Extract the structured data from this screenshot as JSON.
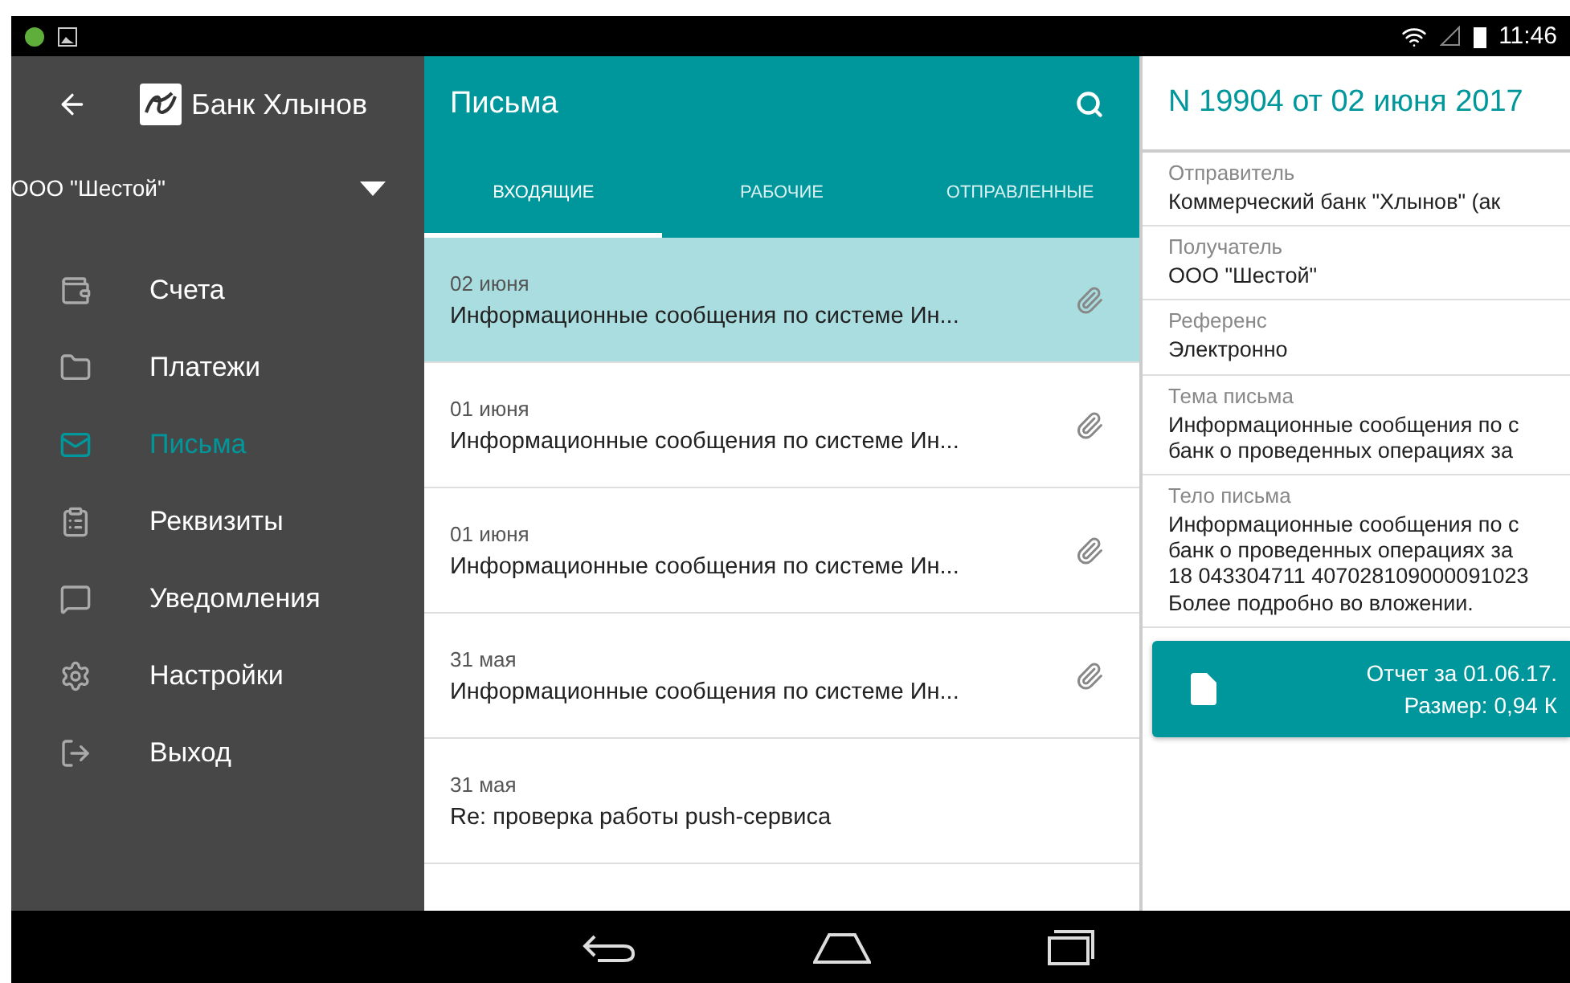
{
  "status_bar": {
    "time": "11:46"
  },
  "sidebar": {
    "bank_name": "Банк Хлынов",
    "organization": "ООО \"Шестой\"",
    "items": [
      {
        "label": "Счета",
        "selected": false
      },
      {
        "label": "Платежи",
        "selected": false
      },
      {
        "label": "Письма",
        "selected": true
      },
      {
        "label": "Реквизиты",
        "selected": false
      },
      {
        "label": "Уведомления",
        "selected": false
      },
      {
        "label": "Настройки",
        "selected": false
      },
      {
        "label": "Выход",
        "selected": false
      }
    ]
  },
  "letters": {
    "title": "Письма",
    "tabs": [
      {
        "label": "ВХОДЯЩИЕ",
        "selected": true
      },
      {
        "label": "РАБОЧИЕ",
        "selected": false
      },
      {
        "label": "ОТПРАВЛЕННЫЕ",
        "selected": false
      }
    ],
    "rows": [
      {
        "date": "02 июня",
        "subject": "Информационные сообщения по системе Ин...",
        "attachment": true,
        "selected": true
      },
      {
        "date": "01 июня",
        "subject": "Информационные сообщения по системе Ин...",
        "attachment": true,
        "selected": false
      },
      {
        "date": "01 июня",
        "subject": "Информационные сообщения по системе Ин...",
        "attachment": true,
        "selected": false
      },
      {
        "date": "31 мая",
        "subject": "Информационные сообщения по системе Ин...",
        "attachment": true,
        "selected": false
      },
      {
        "date": "31 мая",
        "subject": "Re: проверка работы push-сервиса",
        "attachment": false,
        "selected": false
      }
    ]
  },
  "detail": {
    "title": "N 19904 от 02 июня 2017",
    "fields": [
      {
        "label": "Отправитель",
        "lines": [
          "Коммерческий банк \"Хлынов\" (ак"
        ]
      },
      {
        "label": "Получатель",
        "lines": [
          "ООО \"Шестой\""
        ]
      },
      {
        "label": "Референс",
        "lines": [
          "Электронно"
        ]
      },
      {
        "label": "Тема письма",
        "lines": [
          "Информационные сообщения по с",
          "банк о проведенных операциях за"
        ]
      },
      {
        "label": "Тело письма",
        "lines": [
          "Информационные сообщения по с",
          "банк о проведенных операциях за",
          "18 043304711 407028109000091023",
          "Более подробно во вложении."
        ]
      }
    ],
    "attachment": {
      "name": "Отчет за 01.06.17.",
      "size": "Размер: 0,94 К"
    }
  }
}
